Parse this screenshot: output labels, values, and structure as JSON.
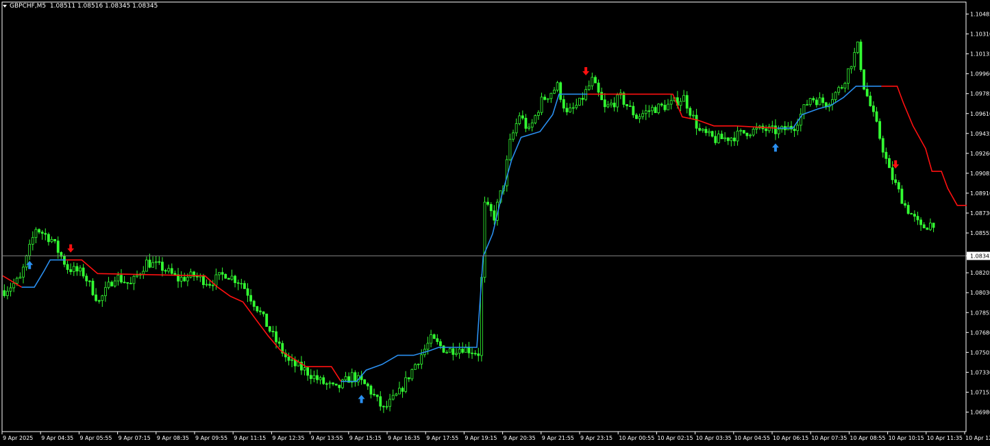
{
  "header": {
    "symbol": "GBPCHF,M5",
    "ohlc": "1.08511 1.08516 1.08345 1.08345"
  },
  "colors": {
    "background": "#000000",
    "grid_border": "#ffffff",
    "candles": "#33ff33",
    "trend_up": "#2a8ff0",
    "trend_down": "#ff1010",
    "bid_line": "#808080"
  },
  "icons": {
    "buy": "arrow-up-icon",
    "sell": "arrow-down-icon",
    "menu": "triangle-down-icon"
  },
  "chart_data": {
    "type": "candlestick",
    "price_axis_labels": [
      "1.10485",
      "1.10310",
      "1.10135",
      "1.09960",
      "1.09785",
      "1.09610",
      "1.09435",
      "1.09260",
      "1.09085",
      "1.08910",
      "1.08730",
      "1.08555",
      "1.08345",
      "1.08205",
      "1.08030",
      "1.07855",
      "1.07680",
      "1.07505",
      "1.07330",
      "1.07155",
      "1.06980"
    ],
    "current_price": "1.08345",
    "ylim": [
      1.0685,
      1.1055
    ],
    "time_axis_labels": [
      "9 Apr 2025",
      "9 Apr 04:35",
      "9 Apr 05:55",
      "9 Apr 07:15",
      "9 Apr 08:35",
      "9 Apr 09:55",
      "9 Apr 11:15",
      "9 Apr 12:35",
      "9 Apr 13:55",
      "9 Apr 15:15",
      "9 Apr 16:35",
      "9 Apr 17:55",
      "9 Apr 19:15",
      "9 Apr 20:35",
      "9 Apr 21:55",
      "9 Apr 23:15",
      "10 Apr 00:55",
      "10 Apr 02:15",
      "10 Apr 03:35",
      "10 Apr 04:55",
      "10 Apr 06:15",
      "10 Apr 07:35",
      "10 Apr 08:55",
      "10 Apr 10:15",
      "10 Apr 11:35",
      "10 Apr 12:5"
    ],
    "price_path": [
      [
        0,
        1.0805
      ],
      [
        5,
        1.0815
      ],
      [
        10,
        1.086
      ],
      [
        15,
        1.085
      ],
      [
        20,
        1.0825
      ],
      [
        25,
        1.082
      ],
      [
        30,
        1.0795
      ],
      [
        35,
        1.0818
      ],
      [
        40,
        1.081
      ],
      [
        45,
        1.083
      ],
      [
        50,
        1.0825
      ],
      [
        55,
        1.0815
      ],
      [
        60,
        1.0818
      ],
      [
        65,
        1.0812
      ],
      [
        70,
        1.082
      ],
      [
        75,
        1.0812
      ],
      [
        80,
        1.079
      ],
      [
        85,
        1.0765
      ],
      [
        90,
        1.0742
      ],
      [
        95,
        1.0735
      ],
      [
        100,
        1.0725
      ],
      [
        105,
        1.0718
      ],
      [
        110,
        1.073
      ],
      [
        115,
        1.072
      ],
      [
        120,
        1.07
      ],
      [
        125,
        1.0715
      ],
      [
        130,
        1.074
      ],
      [
        135,
        1.0762
      ],
      [
        140,
        1.0752
      ],
      [
        145,
        1.0755
      ],
      [
        150,
        1.075
      ],
      [
        152,
        1.088
      ],
      [
        155,
        1.087
      ],
      [
        158,
        1.09
      ],
      [
        160,
        1.0935
      ],
      [
        163,
        1.096
      ],
      [
        166,
        1.0945
      ],
      [
        170,
        1.0972
      ],
      [
        175,
        1.0985
      ],
      [
        178,
        1.096
      ],
      [
        182,
        1.097
      ],
      [
        186,
        1.099
      ],
      [
        190,
        1.0965
      ],
      [
        195,
        1.0975
      ],
      [
        200,
        1.0958
      ],
      [
        205,
        1.0965
      ],
      [
        210,
        1.0968
      ],
      [
        215,
        1.0975
      ],
      [
        220,
        1.0945
      ],
      [
        225,
        1.0938
      ],
      [
        230,
        1.094
      ],
      [
        235,
        1.0945
      ],
      [
        240,
        1.0947
      ],
      [
        245,
        1.0945
      ],
      [
        250,
        1.095
      ],
      [
        255,
        1.0975
      ],
      [
        260,
        1.097
      ],
      [
        265,
        1.0985
      ],
      [
        270,
        1.102
      ],
      [
        272,
        1.0985
      ],
      [
        276,
        1.095
      ],
      [
        280,
        1.091
      ],
      [
        285,
        1.088
      ],
      [
        290,
        1.086
      ],
      [
        294,
        1.0865
      ]
    ],
    "trend_segments": [
      {
        "trend": "down",
        "points": [
          [
            0,
            1.0818
          ],
          [
            6,
            1.0808
          ]
        ]
      },
      {
        "trend": "up",
        "points": [
          [
            6,
            1.0808
          ],
          [
            10,
            1.0808
          ],
          [
            13,
            1.0822
          ],
          [
            15,
            1.0832
          ],
          [
            20,
            1.0832
          ]
        ]
      },
      {
        "trend": "down",
        "points": [
          [
            20,
            1.0832
          ],
          [
            25,
            1.0832
          ],
          [
            30,
            1.082
          ],
          [
            64,
            1.0818
          ],
          [
            68,
            1.0808
          ],
          [
            72,
            1.08
          ],
          [
            76,
            1.0795
          ],
          [
            80,
            1.078
          ],
          [
            84,
            1.0765
          ],
          [
            88,
            1.0752
          ],
          [
            92,
            1.0745
          ],
          [
            96,
            1.0738
          ],
          [
            104,
            1.0738
          ],
          [
            107,
            1.0725
          ]
        ]
      },
      {
        "trend": "up",
        "points": [
          [
            107,
            1.0725
          ],
          [
            112,
            1.0725
          ],
          [
            115,
            1.0735
          ],
          [
            120,
            1.074
          ],
          [
            125,
            1.0748
          ],
          [
            130,
            1.0748
          ],
          [
            135,
            1.0752
          ],
          [
            138,
            1.0755
          ],
          [
            150,
            1.0755
          ],
          [
            152,
            1.0835
          ],
          [
            155,
            1.0855
          ],
          [
            158,
            1.089
          ],
          [
            161,
            1.092
          ],
          [
            164,
            1.094
          ],
          [
            170,
            1.0945
          ],
          [
            174,
            1.096
          ],
          [
            176,
            1.0978
          ],
          [
            185,
            1.0978
          ]
        ]
      },
      {
        "trend": "down",
        "points": [
          [
            185,
            1.0978
          ],
          [
            212,
            1.0978
          ],
          [
            215,
            1.0958
          ],
          [
            220,
            1.0955
          ],
          [
            225,
            1.095
          ],
          [
            232,
            1.095
          ],
          [
            245,
            1.0948
          ]
        ]
      },
      {
        "trend": "up",
        "points": [
          [
            245,
            1.0948
          ],
          [
            250,
            1.0948
          ],
          [
            253,
            1.096
          ],
          [
            258,
            1.0965
          ],
          [
            262,
            1.0968
          ],
          [
            266,
            1.0975
          ],
          [
            270,
            1.0985
          ],
          [
            278,
            1.0985
          ]
        ]
      },
      {
        "trend": "down",
        "points": [
          [
            278,
            1.0985
          ],
          [
            283,
            1.0985
          ],
          [
            285,
            1.097
          ],
          [
            288,
            1.095
          ],
          [
            292,
            1.093
          ],
          [
            294,
            1.091
          ],
          [
            297,
            1.091
          ],
          [
            299,
            1.0895
          ],
          [
            302,
            1.088
          ],
          [
            305,
            1.088
          ]
        ]
      }
    ],
    "signals": [
      {
        "type": "sell",
        "bar": 21
      },
      {
        "type": "buy",
        "bar": 8
      },
      {
        "type": "buy",
        "bar": 113
      },
      {
        "type": "sell",
        "bar": 184
      },
      {
        "type": "buy",
        "bar": 244
      },
      {
        "type": "sell",
        "bar": 282
      }
    ]
  }
}
